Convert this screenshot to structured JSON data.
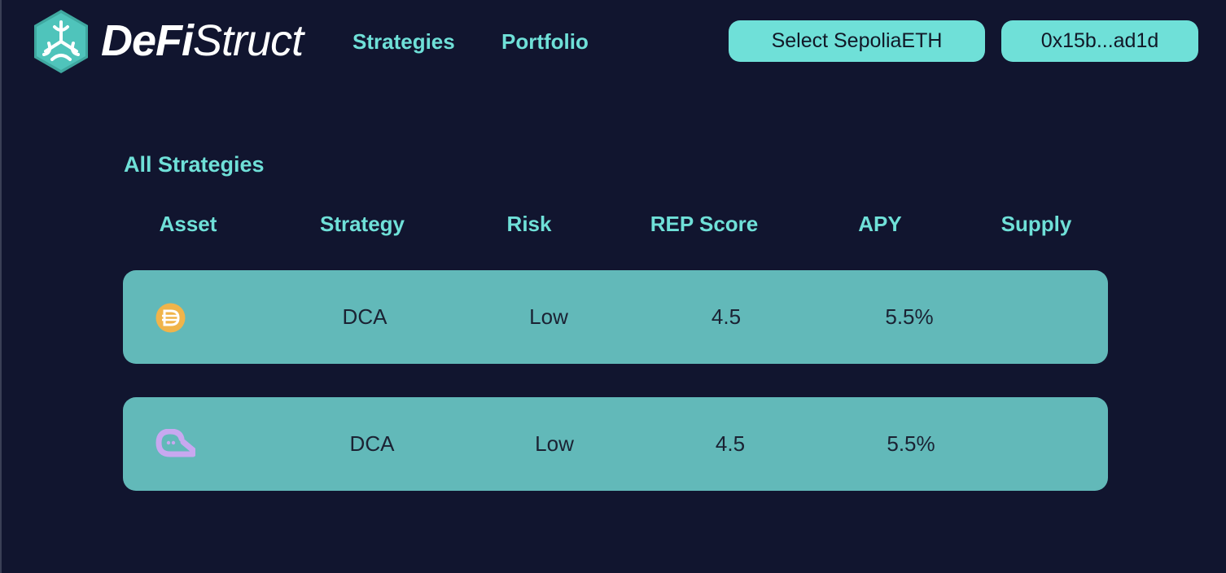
{
  "header": {
    "brand_bold": "DeFi",
    "brand_light": "Struct",
    "nav": [
      {
        "label": "Strategies"
      },
      {
        "label": "Portfolio"
      }
    ],
    "network_button": "Select SepoliaETH",
    "wallet_button": "0x15b...ad1d"
  },
  "section": {
    "title": "All Strategies",
    "columns": [
      "Asset",
      "Strategy",
      "Risk",
      "REP Score",
      "APY",
      "Supply"
    ]
  },
  "rows": [
    {
      "asset_icon": "dai-coin-icon",
      "strategy": "DCA",
      "risk": "Low",
      "rep_score": "4.5",
      "apy": "5.5%",
      "supply": ""
    },
    {
      "asset_icon": "gho-token-icon",
      "strategy": "DCA",
      "risk": "Low",
      "rep_score": "4.5",
      "apy": "5.5%",
      "supply": ""
    }
  ],
  "colors": {
    "background": "#11152f",
    "accent": "#6fe0d8",
    "row": "#62b9b9",
    "dai": "#f0b44a",
    "gho": "#c8a8f0"
  }
}
